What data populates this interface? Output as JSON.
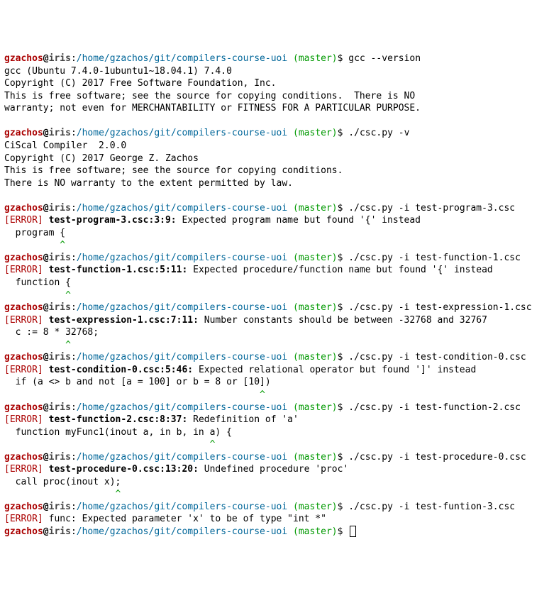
{
  "prompt": {
    "user": "gzachos",
    "at": "@",
    "host": "iris",
    "colon": ":",
    "path": "/home/gzachos/git/compilers-course-uoi",
    "sp": " ",
    "branch": "(master)",
    "dollar": "$ "
  },
  "blocks": [
    {
      "cmd": "gcc --version",
      "out": "gcc (Ubuntu 7.4.0-1ubuntu1~18.04.1) 7.4.0\nCopyright (C) 2017 Free Software Foundation, Inc.\nThis is free software; see the source for copying conditions.  There is NO\nwarranty; not even for MERCHANTABILITY or FITNESS FOR A PARTICULAR PURPOSE.\n"
    },
    {
      "cmd": "./csc.py -v",
      "out": "CiScal Compiler  2.0.0\nCopyright (C) 2017 George Z. Zachos\nThis is free software; see the source for copying conditions.\nThere is NO warranty to the extent permitted by law.\n"
    },
    {
      "cmd": "./csc.py -i test-program-3.csc",
      "err_label": "[ERROR]",
      "err_loc": "test-program-3.csc:3:9:",
      "err_msg": " Expected program name but found '{' instead",
      "ctx": "  program {",
      "caret": "          ^"
    },
    {
      "cmd": "./csc.py -i test-function-1.csc",
      "err_label": "[ERROR]",
      "err_loc": "test-function-1.csc:5:11:",
      "err_msg": " Expected procedure/function name but found '{' instead",
      "ctx": "  function {",
      "caret": "           ^"
    },
    {
      "cmd": "./csc.py -i test-expression-1.csc",
      "err_label": "[ERROR]",
      "err_loc": "test-expression-1.csc:7:11:",
      "err_msg": " Number constants should be between -32768 and 32767",
      "ctx": "  c := 8 * 32768;",
      "caret": "           ^"
    },
    {
      "cmd": "./csc.py -i test-condition-0.csc",
      "err_label": "[ERROR]",
      "err_loc": "test-condition-0.csc:5:46:",
      "err_msg": " Expected relational operator but found ']' instead",
      "ctx": "  if (a <> b and not [a = 100] or b = 8 or [10])",
      "caret": "                                              ^"
    },
    {
      "cmd": "./csc.py -i test-function-2.csc",
      "err_label": "[ERROR]",
      "err_loc": "test-function-2.csc:8:37:",
      "err_msg": " Redefinition of 'a'",
      "ctx": "  function myFunc1(inout a, in b, in a) {",
      "caret": "                                     ^"
    },
    {
      "cmd": "./csc.py -i test-procedure-0.csc",
      "err_label": "[ERROR]",
      "err_loc": "test-procedure-0.csc:13:20:",
      "err_msg": " Undefined procedure 'proc'",
      "ctx": "  call proc(inout x);",
      "caret": "                    ^"
    },
    {
      "cmd": "./csc.py -i test-funtion-3.csc",
      "err_label": "[ERROR]",
      "err_loc_plain": "func:",
      "err_msg": " Expected parameter 'x' to be of type \"int *\""
    },
    {
      "cmd": "",
      "cursor": true
    }
  ]
}
